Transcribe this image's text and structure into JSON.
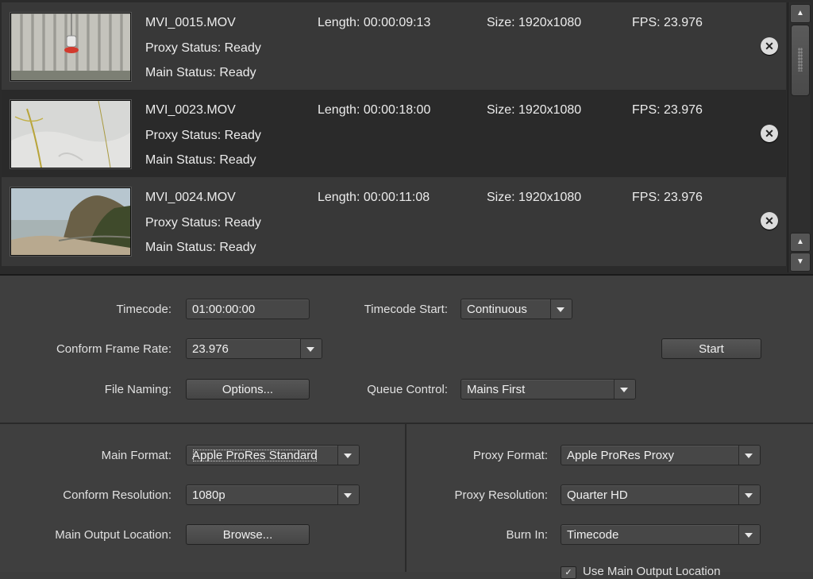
{
  "clips": [
    {
      "name": "MVI_0015.MOV",
      "length": "Length: 00:00:09:13",
      "size": "Size: 1920x1080",
      "fps": "FPS: 23.976",
      "proxy_status": "Proxy Status: Ready",
      "main_status": "Main Status: Ready"
    },
    {
      "name": "MVI_0023.MOV",
      "length": "Length: 00:00:18:00",
      "size": "Size: 1920x1080",
      "fps": "FPS: 23.976",
      "proxy_status": "Proxy Status: Ready",
      "main_status": "Main Status: Ready"
    },
    {
      "name": "MVI_0024.MOV",
      "length": "Length: 00:00:11:08",
      "size": "Size: 1920x1080",
      "fps": "FPS: 23.976",
      "proxy_status": "Proxy Status: Ready",
      "main_status": "Main Status: Ready"
    }
  ],
  "remove_icon": "close-icon",
  "remove_glyph": "✕",
  "scroll": {
    "up_glyph": "▲",
    "down_glyph": "▼",
    "top_glyph": "▲"
  },
  "settings": {
    "timecode_label": "Timecode:",
    "timecode_value": "01:00:00:00",
    "timecode_start_label": "Timecode Start:",
    "timecode_start_value": "Continuous",
    "conform_frame_rate_label": "Conform Frame Rate:",
    "conform_frame_rate_value": "23.976",
    "start_label": "Start",
    "file_naming_label": "File Naming:",
    "options_label": "Options...",
    "queue_control_label": "Queue Control:",
    "queue_control_value": "Mains First",
    "main_format_label": "Main Format:",
    "main_format_value": "Apple ProRes Standard",
    "conform_resolution_label": "Conform Resolution:",
    "conform_resolution_value": "1080p",
    "main_output_label": "Main Output Location:",
    "browse_label": "Browse...",
    "proxy_format_label": "Proxy Format:",
    "proxy_format_value": "Apple ProRes Proxy",
    "proxy_resolution_label": "Proxy Resolution:",
    "proxy_resolution_value": "Quarter HD",
    "burn_in_label": "Burn In:",
    "burn_in_value": "Timecode",
    "checkbox_label": "Use Main Output Location",
    "checkbox_glyph": "✓"
  },
  "colors": {
    "panel": "#3f3f3f",
    "list_bg": "#2b2b2b",
    "text": "#e6e6e6"
  }
}
